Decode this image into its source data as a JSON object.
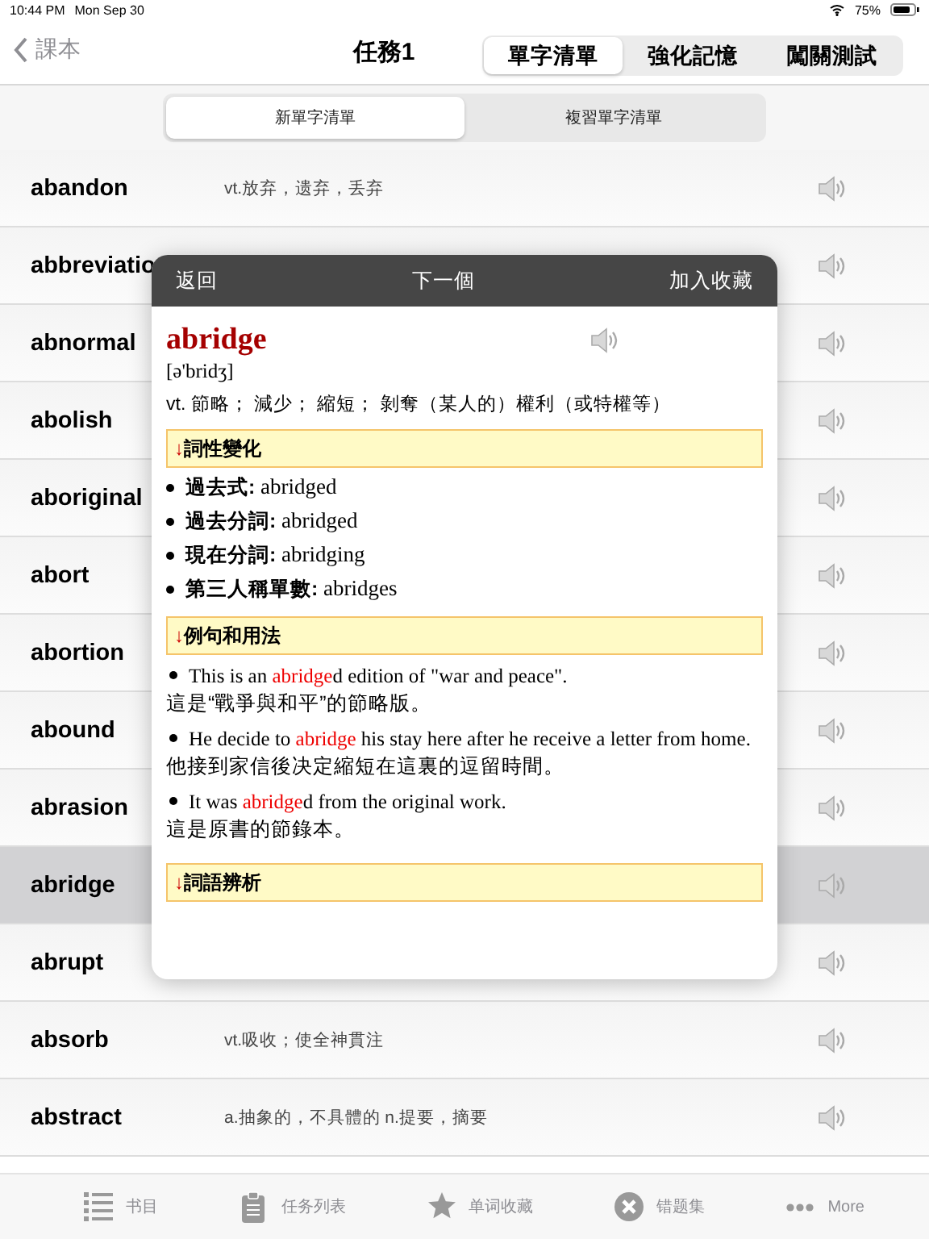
{
  "status_bar": {
    "time": "10:44 PM",
    "date": "Mon Sep 30",
    "battery": "75%"
  },
  "nav": {
    "back": "課本",
    "title": "任務1",
    "segments": [
      {
        "label": "單字清單",
        "selected": true
      },
      {
        "label": "強化記憶",
        "selected": false
      },
      {
        "label": "闖關測試",
        "selected": false
      }
    ]
  },
  "sub_segments": [
    {
      "label": "新單字清單",
      "selected": true
    },
    {
      "label": "複習單字清單",
      "selected": false
    }
  ],
  "words": [
    {
      "word": "abandon",
      "meaning": "vt.放弃，遗弃，丢弃",
      "selected": false
    },
    {
      "word": "abbreviatio",
      "selected": false
    },
    {
      "word": "abnormal",
      "selected": false
    },
    {
      "word": "abolish",
      "selected": false
    },
    {
      "word": "aboriginal",
      "selected": false
    },
    {
      "word": "abort",
      "selected": false
    },
    {
      "word": "abortion",
      "selected": false
    },
    {
      "word": "abound",
      "selected": false
    },
    {
      "word": "abrasion",
      "selected": false
    },
    {
      "word": "abridge",
      "selected": true
    },
    {
      "word": "abrupt",
      "selected": false
    },
    {
      "word": "absorb",
      "meaning": "vt.吸收；使全神貫注",
      "selected": false
    },
    {
      "word": "abstract",
      "meaning": "a.抽象的，不具體的 n.提要，摘要",
      "selected": false
    }
  ],
  "popup": {
    "back": "返回",
    "next": "下一個",
    "favorite": "加入收藏",
    "word": "abridge",
    "phonetic": "[ə'bridʒ]",
    "definition": "vt. 節略； 減少； 縮短； 剝奪（某人的）權利（或特權等）",
    "sections": [
      {
        "marker": "↓",
        "title": "詞性變化",
        "kind": "forms",
        "items": [
          "**過去式:** abridged",
          "**過去分詞:** abridged",
          "**現在分詞:** abridging",
          "**第三人稱單數:** abridges"
        ]
      },
      {
        "marker": "↓",
        "title": "例句和用法",
        "kind": "examples",
        "items": [
          {
            "parts": [
              {
                "text": "This is an ",
                "highlight": false
              },
              {
                "text": "abridge",
                "highlight": true
              },
              {
                "text": "d edition of \"war and peace\".",
                "highlight": false
              }
            ],
            "translation": "這是“戰爭與和平”的節略版。"
          },
          {
            "parts": [
              {
                "text": "He decide to ",
                "highlight": false
              },
              {
                "text": "abridge",
                "highlight": true
              },
              {
                "text": " his stay here after he receive a letter from home.",
                "highlight": false
              }
            ],
            "translation": "他接到家信後决定縮短在這裏的逗留時間。"
          },
          {
            "parts": [
              {
                "text": "It was ",
                "highlight": false
              },
              {
                "text": "abridge",
                "highlight": true
              },
              {
                "text": "d from the original work.",
                "highlight": false
              }
            ],
            "translation": "這是原書的節錄本。"
          }
        ]
      },
      {
        "marker": "↓",
        "title": "詞語辨析",
        "kind": "empty"
      }
    ]
  },
  "tab_bar": [
    {
      "label": "书目"
    },
    {
      "label": "任务列表"
    },
    {
      "label": "单词收藏"
    },
    {
      "label": "错题集"
    },
    {
      "label": "More"
    }
  ]
}
